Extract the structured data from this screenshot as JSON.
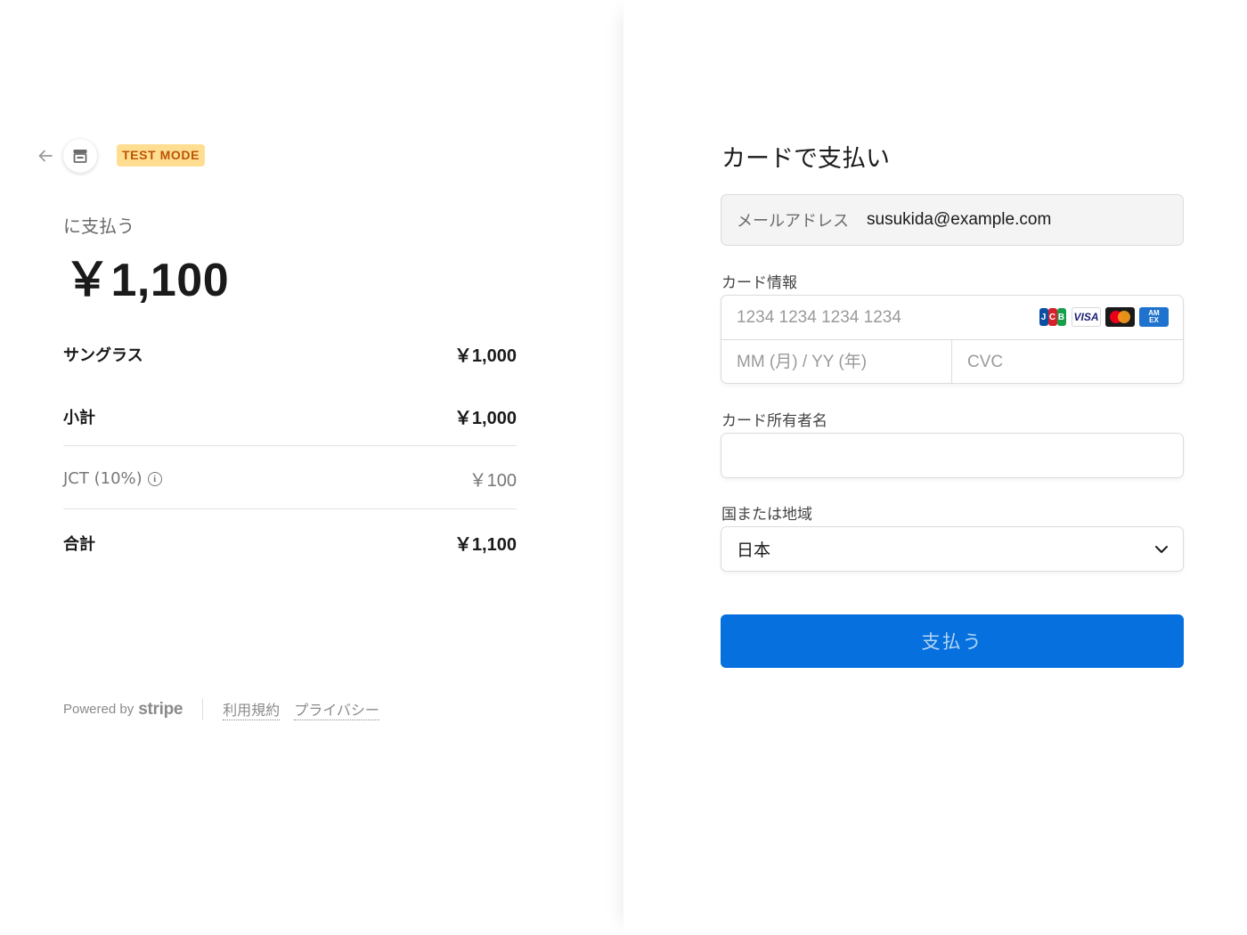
{
  "header": {
    "back_icon": "arrow-left-icon",
    "store_icon": "store-icon",
    "test_mode_badge": "TEST MODE"
  },
  "summary": {
    "pay_to_label": "に支払う",
    "total_amount": "￥1,100",
    "items": [
      {
        "name": "サングラス",
        "price": "￥1,000"
      }
    ],
    "subtotal_label": "小計",
    "subtotal_value": "￥1,000",
    "tax_label": "JCT (10%)",
    "tax_value": "￥100",
    "total_label": "合計",
    "total_value": "￥1,100"
  },
  "footer": {
    "powered_by": "Powered by",
    "brand": "stripe",
    "links": [
      "利用規約",
      "プライバシー"
    ]
  },
  "form": {
    "title": "カードで支払い",
    "email_label": "メールアドレス",
    "email_value": "susukida@example.com",
    "card_info_label": "カード情報",
    "card_number_placeholder": "1234 1234 1234 1234",
    "card_brands": [
      "JCB",
      "VISA",
      "Mastercard",
      "AMEX"
    ],
    "expiry_placeholder": "MM (月) / YY (年)",
    "cvc_placeholder": "CVC",
    "cardholder_label": "カード所有者名",
    "cardholder_value": "",
    "country_label": "国または地域",
    "country_value": "日本",
    "pay_button": "支払う"
  },
  "colors": {
    "accent": "#0570de",
    "test_badge_bg": "#ffde92",
    "test_badge_text": "#bb5504"
  }
}
